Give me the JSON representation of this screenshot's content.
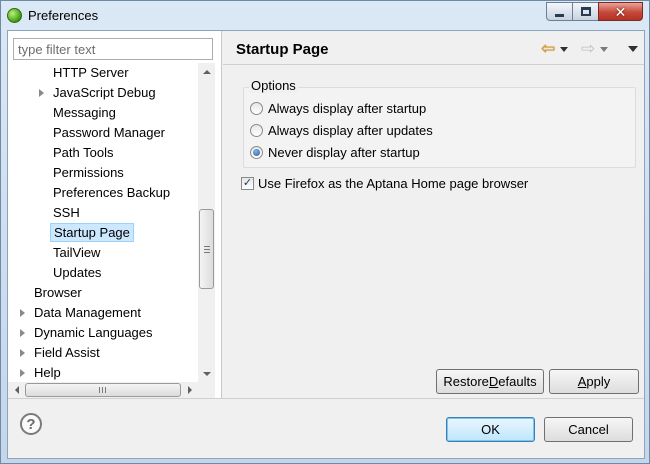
{
  "window": {
    "title": "Preferences"
  },
  "filter": {
    "placeholder": "type filter text"
  },
  "tree": {
    "items": [
      {
        "label": "HTTP Server",
        "level": 2,
        "expander": false,
        "selected": false
      },
      {
        "label": "JavaScript Debug",
        "level": 2,
        "expander": true,
        "selected": false
      },
      {
        "label": "Messaging",
        "level": 2,
        "expander": false,
        "selected": false
      },
      {
        "label": "Password Manager",
        "level": 2,
        "expander": false,
        "selected": false
      },
      {
        "label": "Path Tools",
        "level": 2,
        "expander": false,
        "selected": false
      },
      {
        "label": "Permissions",
        "level": 2,
        "expander": false,
        "selected": false
      },
      {
        "label": "Preferences Backup",
        "level": 2,
        "expander": false,
        "selected": false
      },
      {
        "label": "SSH",
        "level": 2,
        "expander": false,
        "selected": false
      },
      {
        "label": "Startup Page",
        "level": 2,
        "expander": false,
        "selected": true
      },
      {
        "label": "TailView",
        "level": 2,
        "expander": false,
        "selected": false
      },
      {
        "label": "Updates",
        "level": 2,
        "expander": false,
        "selected": false
      },
      {
        "label": "Browser",
        "level": 1,
        "expander": false,
        "selected": false
      },
      {
        "label": "Data Management",
        "level": 1,
        "expander": true,
        "selected": false
      },
      {
        "label": "Dynamic Languages",
        "level": 1,
        "expander": true,
        "selected": false
      },
      {
        "label": "Field Assist",
        "level": 1,
        "expander": true,
        "selected": false
      },
      {
        "label": "Help",
        "level": 1,
        "expander": true,
        "selected": false
      }
    ]
  },
  "page": {
    "title": "Startup Page",
    "options_label": "Options",
    "radios": [
      {
        "label": "Always display after startup",
        "checked": false
      },
      {
        "label": "Always display after updates",
        "checked": false
      },
      {
        "label": "Never display after startup",
        "checked": true
      }
    ],
    "checkbox": {
      "label": "Use Firefox as the Aptana Home page browser",
      "checked": true
    },
    "restore_pre": "Restore ",
    "restore_key": "D",
    "restore_post": "efaults",
    "apply_key": "A",
    "apply_post": "pply"
  },
  "footer": {
    "ok": "OK",
    "cancel": "Cancel",
    "help_glyph": "?"
  },
  "icons": {
    "app": "eclipse-green-icon",
    "back": "back-arrow-icon",
    "forward": "forward-arrow-icon",
    "menu": "view-menu-icon",
    "help": "help-icon"
  },
  "colors": {
    "selection": "#cce8ff",
    "selection_border": "#99d1ff",
    "close_button": "#c6483a",
    "default_button": "#bee6fd"
  }
}
